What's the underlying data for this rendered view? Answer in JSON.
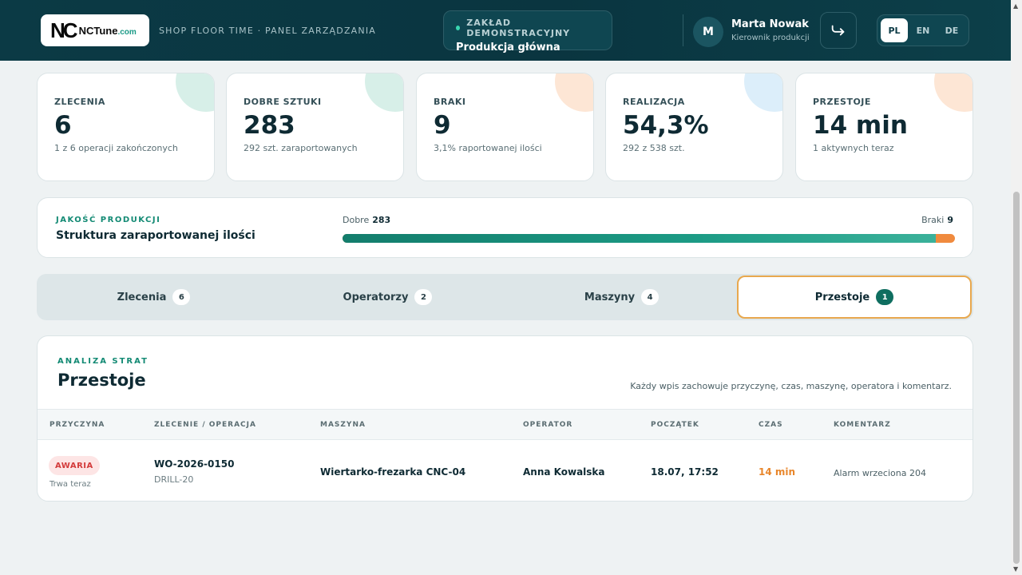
{
  "header": {
    "logo_mark": "NC",
    "logo_name": "NCTune",
    "logo_domain": ".com",
    "subtitle": "SHOP FLOOR TIME · PANEL ZARZĄDZANIA",
    "plant_label": "ZAKŁAD DEMONSTRACYJNY",
    "plant_name": "Produkcja główna",
    "user_initial": "M",
    "user_name": "Marta Nowak",
    "user_role": "Kierownik produkcji",
    "languages": [
      "PL",
      "EN",
      "DE"
    ],
    "active_language": "PL"
  },
  "kpis": [
    {
      "label": "ZLECENIA",
      "value": "6",
      "sub": "1 z 6 operacji zakończonych",
      "color": "#d7efe8"
    },
    {
      "label": "DOBRE SZTUKI",
      "value": "283",
      "sub": "292 szt. zaraportowanych",
      "color": "#d7efe8"
    },
    {
      "label": "BRAKI",
      "value": "9",
      "sub": "3,1% raportowanej ilości",
      "color": "#fde6d5"
    },
    {
      "label": "REALIZACJA",
      "value": "54,3%",
      "sub": "292 z 538 szt.",
      "color": "#dceefa"
    },
    {
      "label": "PRZESTOJE",
      "value": "14 min",
      "sub": "1 aktywnych teraz",
      "color": "#fde6d5"
    }
  ],
  "quality": {
    "eyebrow": "JAKOŚĆ PRODUKCJI",
    "title": "Struktura zaraportowanej ilości",
    "good_label": "Dobre",
    "good_value": "283",
    "bad_label": "Braki",
    "bad_value": "9",
    "good_fraction": 0.969
  },
  "tabs": [
    {
      "label": "Zlecenia",
      "count": "6"
    },
    {
      "label": "Operatorzy",
      "count": "2"
    },
    {
      "label": "Maszyny",
      "count": "4"
    },
    {
      "label": "Przestoje",
      "count": "1"
    }
  ],
  "panel": {
    "eyebrow": "ANALIZA STRAT",
    "title": "Przestoje",
    "description": "Każdy wpis zachowuje przyczynę, czas, maszynę, operatora i komentarz.",
    "columns": [
      "PRZYCZYNA",
      "ZLECENIE / OPERACJA",
      "MASZYNA",
      "OPERATOR",
      "POCZĄTEK",
      "CZAS",
      "KOMENTARZ"
    ],
    "rows": [
      {
        "reason": "AWARIA",
        "reason_status": "Trwa teraz",
        "order": "WO-2026-0150",
        "operation": "DRILL-20",
        "machine": "Wiertarko-frezarka CNC-04",
        "operator": "Anna Kowalska",
        "start": "18.07, 17:52",
        "duration": "14 min",
        "comment": "Alarm wrzeciona 204"
      }
    ]
  },
  "colors": {
    "header_bg": "#0b3a45",
    "accent_teal": "#138a74",
    "warning_orange": "#e8862b",
    "danger_red": "#d33b3b",
    "active_tab_border": "#e8a84e"
  }
}
